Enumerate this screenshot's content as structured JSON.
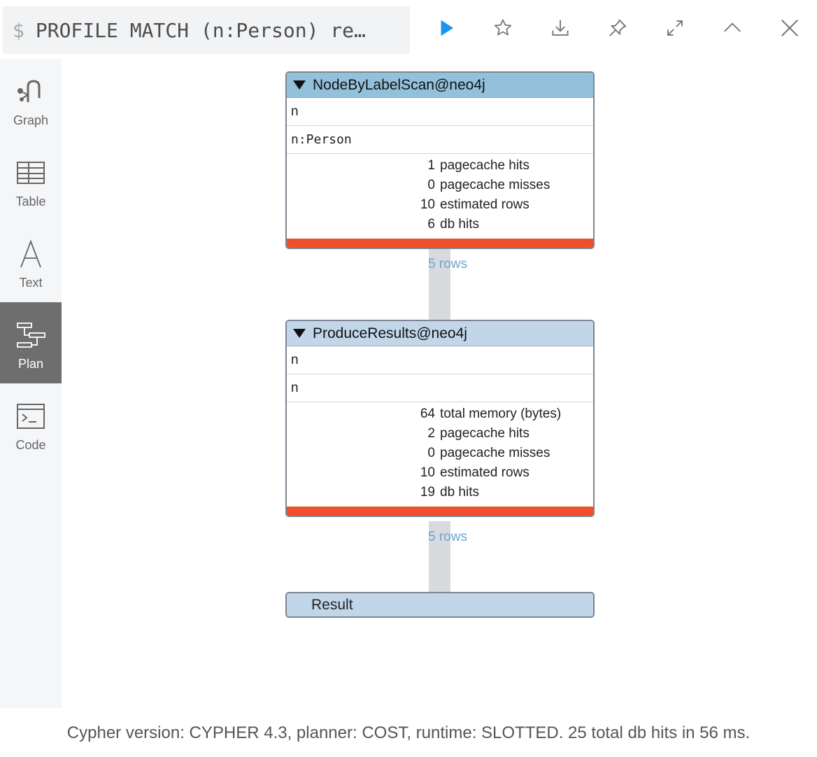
{
  "query": {
    "prompt": "$",
    "text": "PROFILE MATCH (n:Person) re…"
  },
  "toolbar": [
    "run",
    "favorite",
    "download",
    "pin",
    "expand",
    "collapse",
    "close"
  ],
  "sidebar": {
    "items": [
      {
        "label": "Graph",
        "icon": "graph-icon"
      },
      {
        "label": "Table",
        "icon": "table-icon"
      },
      {
        "label": "Text",
        "icon": "text-icon"
      },
      {
        "label": "Plan",
        "icon": "plan-icon",
        "active": true
      },
      {
        "label": "Code",
        "icon": "code-icon"
      }
    ]
  },
  "plan": {
    "op1": {
      "name": "NodeByLabelScan@neo4j",
      "identifiers": "n",
      "details": "n:Person",
      "stats": [
        {
          "value": "1",
          "label": "pagecache hits"
        },
        {
          "value": "0",
          "label": "pagecache misses"
        },
        {
          "value": "10",
          "label": "estimated rows"
        },
        {
          "value": "6",
          "label": "db hits"
        }
      ]
    },
    "link1": "5 rows",
    "op2": {
      "name": "ProduceResults@neo4j",
      "identifiers": "n",
      "details": "n",
      "stats": [
        {
          "value": "64",
          "label": "total memory (bytes)"
        },
        {
          "value": "2",
          "label": "pagecache hits"
        },
        {
          "value": "0",
          "label": "pagecache misses"
        },
        {
          "value": "10",
          "label": "estimated rows"
        },
        {
          "value": "19",
          "label": "db hits"
        }
      ]
    },
    "link2": "5 rows",
    "result": "Result"
  },
  "footer": "Cypher version: CYPHER 4.3, planner: COST, runtime: SLOTTED. 25 total db hits in 56 ms.",
  "colors": {
    "header1": "#93c1db",
    "header2": "#c2d6ea",
    "costbar": "#ef4f2c",
    "rowsText": "#6aa6d0",
    "runIcon": "#1b93f0"
  }
}
